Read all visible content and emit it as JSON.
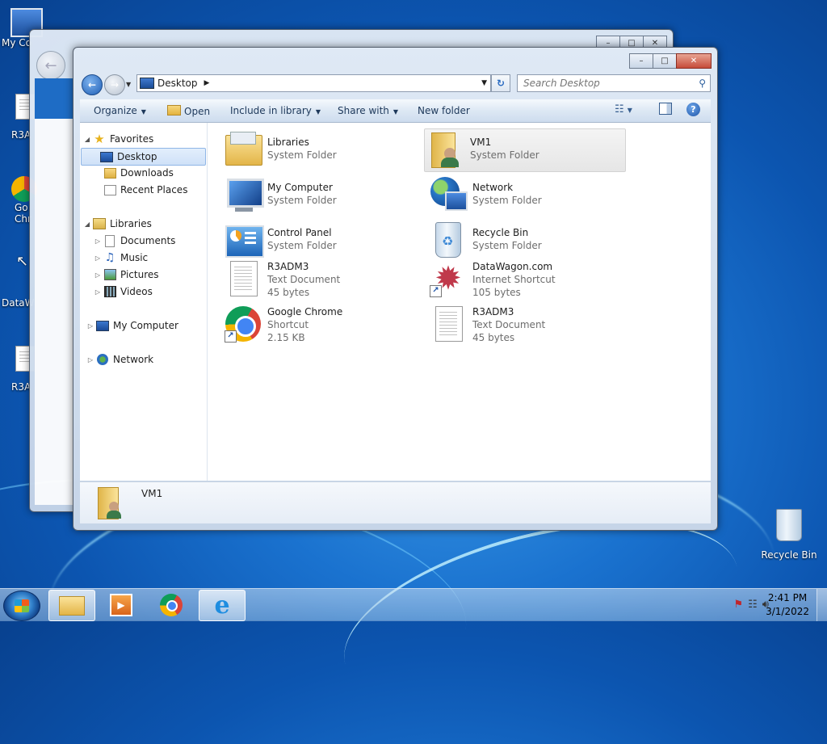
{
  "desktop": {
    "icons": [
      {
        "label": "My Co"
      },
      {
        "label": "R3A"
      },
      {
        "label": "Go"
      },
      {
        "label": "Chr"
      },
      {
        "label": "DataW"
      },
      {
        "label": "R3A"
      },
      {
        "label": "Recycle Bin"
      }
    ]
  },
  "window": {
    "address": {
      "crumb": "Desktop"
    },
    "search": {
      "placeholder": "Search Desktop"
    },
    "toolbar": {
      "organize": "Organize",
      "open": "Open",
      "include_in_library": "Include in library",
      "share_with": "Share with",
      "new_folder": "New folder"
    },
    "nav": {
      "favorites": "Favorites",
      "desktop": "Desktop",
      "downloads": "Downloads",
      "recent_places": "Recent Places",
      "libraries": "Libraries",
      "documents": "Documents",
      "music": "Music",
      "pictures": "Pictures",
      "videos": "Videos",
      "my_computer": "My Computer",
      "network": "Network"
    },
    "items": [
      {
        "name": "Libraries",
        "line1": "System Folder",
        "line2": ""
      },
      {
        "name": "VM1",
        "line1": "System Folder",
        "line2": ""
      },
      {
        "name": "My Computer",
        "line1": "System Folder",
        "line2": ""
      },
      {
        "name": "Network",
        "line1": "System Folder",
        "line2": ""
      },
      {
        "name": "Control Panel",
        "line1": "System Folder",
        "line2": ""
      },
      {
        "name": "Recycle Bin",
        "line1": "System Folder",
        "line2": ""
      },
      {
        "name": "R3ADM3",
        "line1": "Text Document",
        "line2": "45 bytes"
      },
      {
        "name": "DataWagon.com",
        "line1": "Internet Shortcut",
        "line2": "105 bytes"
      },
      {
        "name": "Google Chrome",
        "line1": "Shortcut",
        "line2": "2.15 KB"
      },
      {
        "name": "R3ADM3",
        "line1": "Text Document",
        "line2": "45 bytes"
      }
    ],
    "details": {
      "name": "VM1"
    }
  },
  "taskbar": {
    "time": "2:41 PM",
    "date": "3/1/2022"
  },
  "colors": {
    "accent": "#1a72cf",
    "selection": "#cfe1f8",
    "close": "#c64c3a"
  }
}
